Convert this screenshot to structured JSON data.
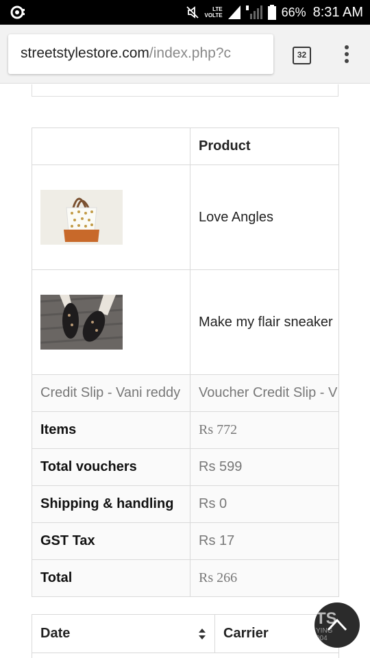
{
  "status_bar": {
    "network": "LTE",
    "volte": "VOLTE",
    "battery": "66%",
    "time": "8:31 AM"
  },
  "browser": {
    "url_host": "streetstylestore.com",
    "url_path": "/index.php?c",
    "tab_count": "32"
  },
  "order_table": {
    "header": {
      "col1": "",
      "col2": "Product"
    },
    "products": [
      {
        "image": "tote-bag-image",
        "name": "Love Angles"
      },
      {
        "image": "sneakers-image",
        "name": "Make my flair sneaker"
      }
    ],
    "credit_slip": {
      "col1": "Credit Slip - Vani reddy",
      "col2": "Voucher Credit Slip - V"
    },
    "summary": [
      {
        "label": "Items",
        "value": "Rs 772"
      },
      {
        "label": "Total vouchers",
        "value": "Rs 599"
      },
      {
        "label": "Shipping & handling",
        "value": "Rs 0"
      },
      {
        "label": "GST Tax",
        "value": "Rs 17"
      },
      {
        "label": "Total",
        "value": "Rs 266"
      }
    ]
  },
  "shipping_table": {
    "date_header": "Date",
    "carrier_header": "Carrier"
  },
  "scroll_top": {
    "watermark_line1": "TS",
    "watermark_line2": "YING\n004"
  }
}
